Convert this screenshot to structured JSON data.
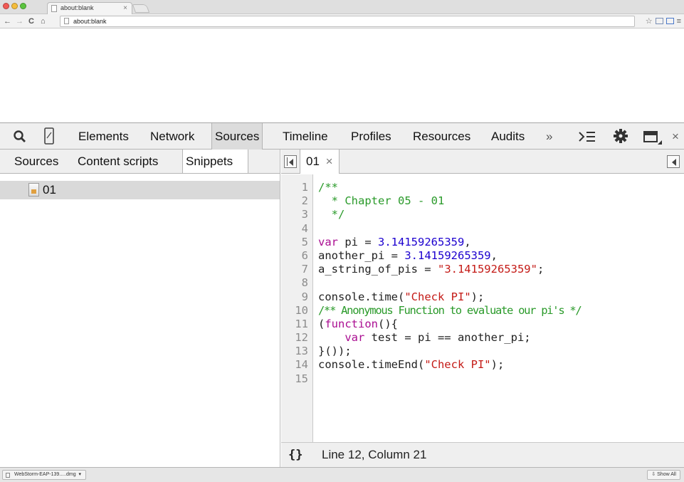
{
  "browser": {
    "tab_title": "about:blank",
    "tab_close": "×",
    "url": "about:blank",
    "nav": {
      "back": "←",
      "forward": "→",
      "reload": "C",
      "home": "⌂"
    },
    "star": "☆"
  },
  "devtools": {
    "tabs": [
      "Elements",
      "Network",
      "Sources",
      "Timeline",
      "Profiles",
      "Resources",
      "Audits"
    ],
    "active_tab": "Sources",
    "overflow": "»",
    "close": "×",
    "navigator_tabs": [
      "Sources",
      "Content scripts",
      "Snippets"
    ],
    "active_navigator_tab": "Snippets",
    "snippet_file": "01",
    "editor_tab": {
      "label": "01",
      "close": "×"
    },
    "code_lines": [
      "1",
      "2",
      "3",
      "4",
      "5",
      "6",
      "7",
      "8",
      "9",
      "10",
      "11",
      "12",
      "13",
      "14",
      "15"
    ],
    "code": {
      "l1": "/**",
      "l2": "  * Chapter 05 - 01",
      "l3": "  */",
      "l5_kw": "var",
      "l5_mid": " pi = ",
      "l5_num": "3.14159265359",
      "l5_end": ",",
      "l6_a": "another_pi = ",
      "l6_num": "3.14159265359",
      "l6_end": ",",
      "l7_a": "a_string_of_pis = ",
      "l7_str": "\"3.14159265359\"",
      "l7_end": ";",
      "l9_a": "console.time(",
      "l9_str": "\"Check PI\"",
      "l9_end": ");",
      "l10": "/** Anonymous Function to evaluate our pi's */",
      "l11_a": "(",
      "l11_kw": "function",
      "l11_end": "(){",
      "l12_pre": "    ",
      "l12_kw": "var",
      "l12_rest": " test = pi == another_pi;",
      "l13": "}());",
      "l14_a": "console.timeEnd(",
      "l14_str": "\"Check PI\"",
      "l14_end": ");"
    },
    "status": {
      "braces": "{}",
      "position": "Line 12, Column 21"
    }
  },
  "downloads": {
    "item": "WebStorm-EAP-139.....dmg",
    "show_all": "Show All"
  },
  "colors": {
    "comment": "#2a9a2a",
    "keyword": "#aa0d91",
    "number": "#1c00cf",
    "string": "#c41a16"
  }
}
